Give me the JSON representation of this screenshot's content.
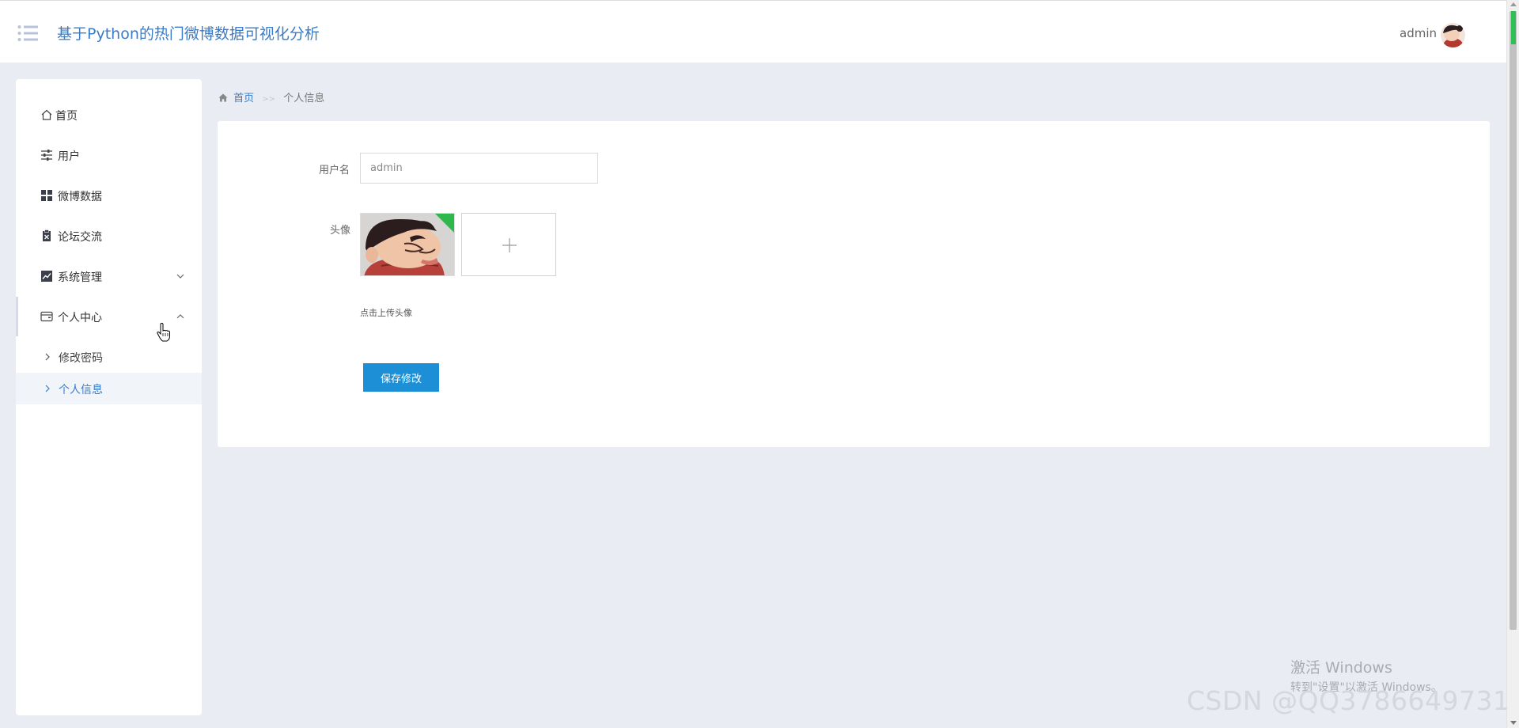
{
  "header": {
    "app_title": "基于Python的热门微博数据可视化分析",
    "user_name": "admin",
    "menu_icon": "list-menu-icon",
    "avatar_icon": "user-avatar-icon"
  },
  "sidebar": {
    "items": [
      {
        "label": "首页",
        "icon": "home-icon"
      },
      {
        "label": "用户",
        "icon": "sliders-icon"
      },
      {
        "label": "微博数据",
        "icon": "grid-icon"
      },
      {
        "label": "论坛交流",
        "icon": "clipboard-icon"
      },
      {
        "label": "系统管理",
        "icon": "chart-icon",
        "expanded": false
      },
      {
        "label": "个人中心",
        "icon": "wallet-icon",
        "expanded": true
      }
    ],
    "sub_items": [
      {
        "label": "修改密码"
      },
      {
        "label": "个人信息",
        "current": true
      }
    ]
  },
  "breadcrumb": {
    "home": "首页",
    "separator": ">>",
    "current": "个人信息"
  },
  "form": {
    "username_label": "用户名",
    "username_value": "admin",
    "avatar_label": "头像",
    "upload_hint": "点击上传头像",
    "save_label": "保存修改"
  },
  "watermark": {
    "title": "激活 Windows",
    "subtitle": "转到\"设置\"以激活 Windows。",
    "csdn": "CSDN @QQ3786649731"
  },
  "colors": {
    "accent": "#3a7bc8",
    "button": "#1d8fd6",
    "page_bg": "#e9ecf3"
  }
}
